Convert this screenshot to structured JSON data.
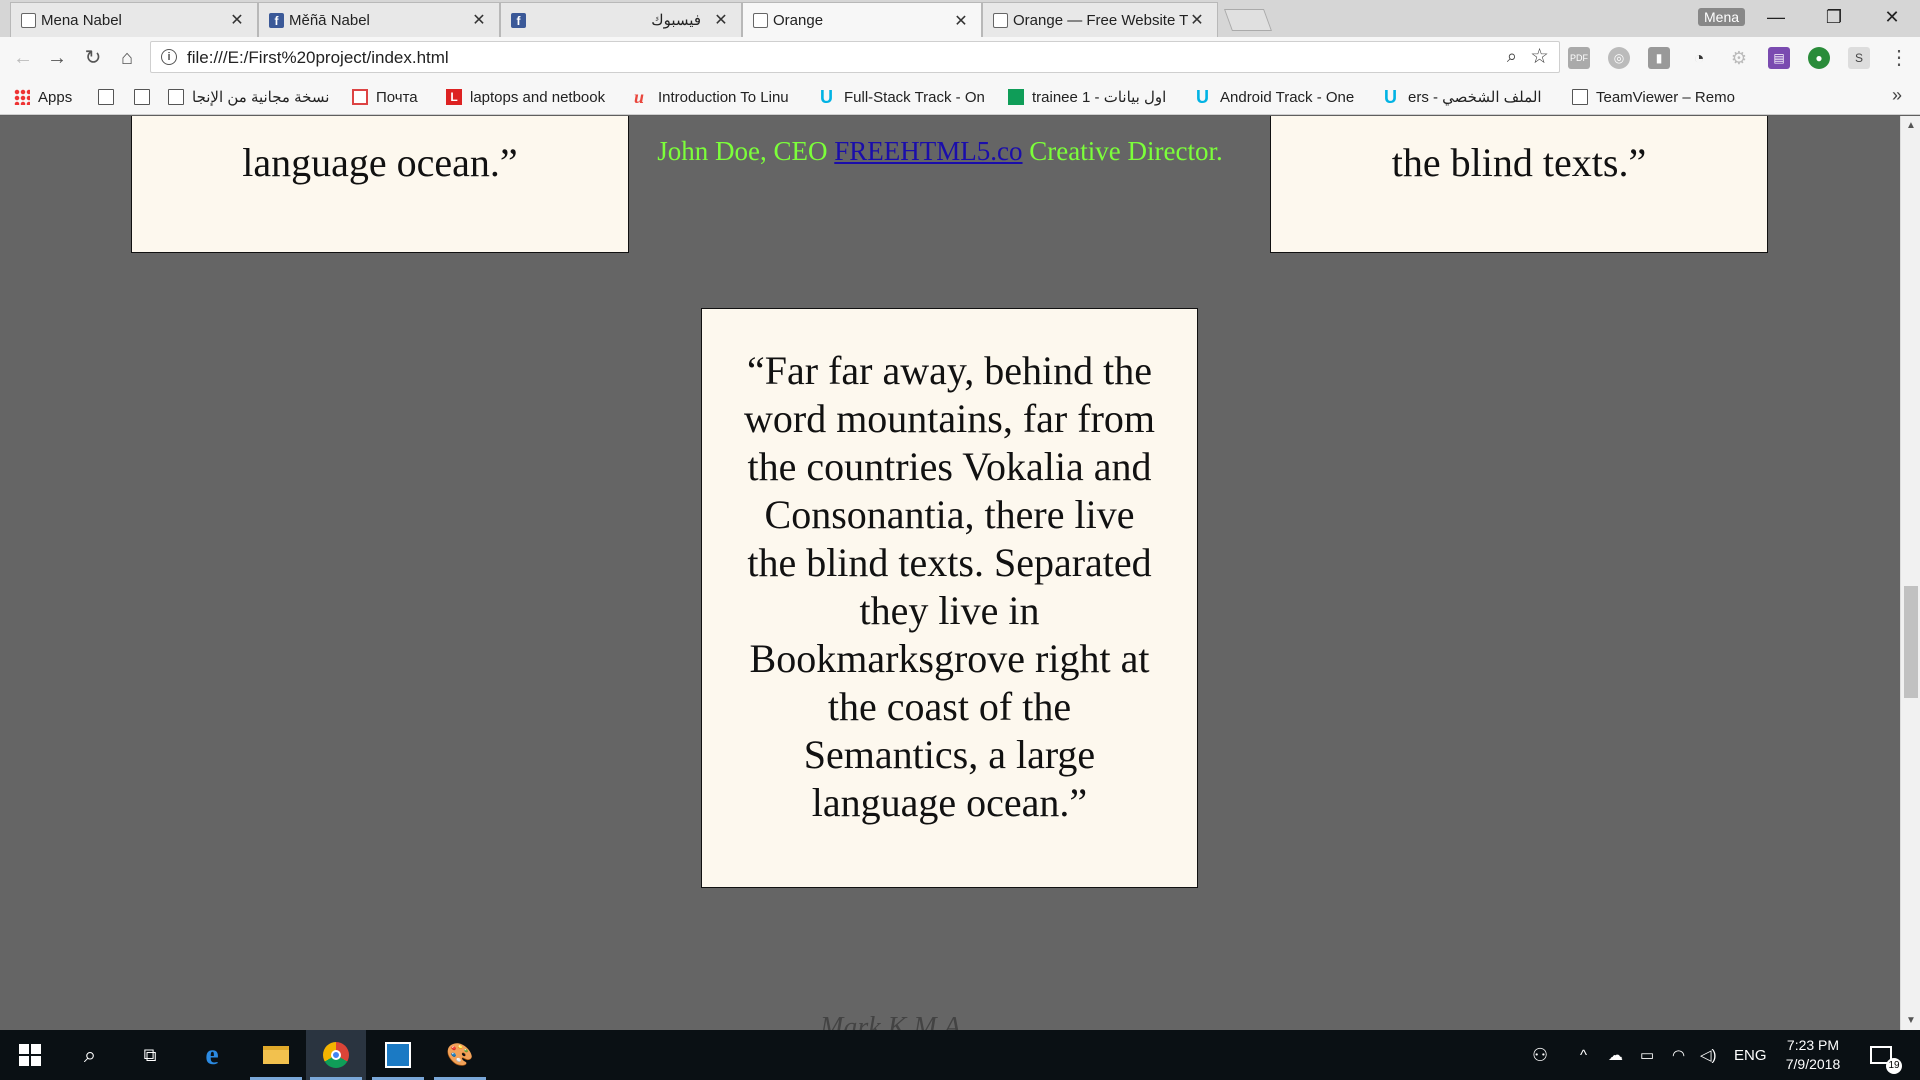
{
  "tabs": [
    {
      "title": "Mena Nabel",
      "icon": "page-icon"
    },
    {
      "title": "Měñā Nabel",
      "icon": "facebook-icon"
    },
    {
      "title": "فيسبوك",
      "icon": "facebook-icon"
    },
    {
      "title": "Orange",
      "icon": "page-icon"
    },
    {
      "title": "Orange — Free Website T",
      "icon": "page-icon"
    }
  ],
  "profile_name": "Mena",
  "window_controls": {
    "minimize": "—",
    "restore": "❐",
    "close": "✕"
  },
  "toolbar": {
    "url": "file:///E:/First%20project/index.html"
  },
  "bookmarks": [
    {
      "label": "Apps",
      "icon": "apps-icon"
    },
    {
      "label": "",
      "icon": "page-icon"
    },
    {
      "label": "",
      "icon": "page-icon"
    },
    {
      "label": "نسخة مجانية من الإنجا",
      "icon": "page-icon"
    },
    {
      "label": "Почта",
      "icon": "mail-icon"
    },
    {
      "label": "laptops and netbook",
      "icon": "l-icon"
    },
    {
      "label": "Introduction To Linu",
      "icon": "udemy-icon"
    },
    {
      "label": "Full-Stack Track - On",
      "icon": "udacity-icon"
    },
    {
      "label": "trainee 1 - اول بيانات",
      "icon": "sheets-icon"
    },
    {
      "label": "Android Track - One",
      "icon": "udacity-icon"
    },
    {
      "label": "ers - الملف الشخصي",
      "icon": "udacity-icon"
    },
    {
      "label": "TeamViewer – Remo",
      "icon": "page-icon"
    }
  ],
  "bookmarks_overflow": "»",
  "page": {
    "left_card_text": "language ocean.”",
    "right_card_text": "the blind texts.”",
    "credit": {
      "before": "John Doe, CEO ",
      "link": "FREEHTML5.co",
      "after": " Creative Director."
    },
    "center_card_text": "“Far far away, behind the word mountains, far from the countries Vokalia and Consonantia, there live the blind texts. Separated they live in Bookmarksgrove right at the coast of the Semantics, a large language ocean.”",
    "watermark": "Mark K.M.A"
  },
  "taskbar": {
    "language": "ENG",
    "time": "7:23 PM",
    "date": "7/9/2018",
    "notification_count": "19"
  }
}
